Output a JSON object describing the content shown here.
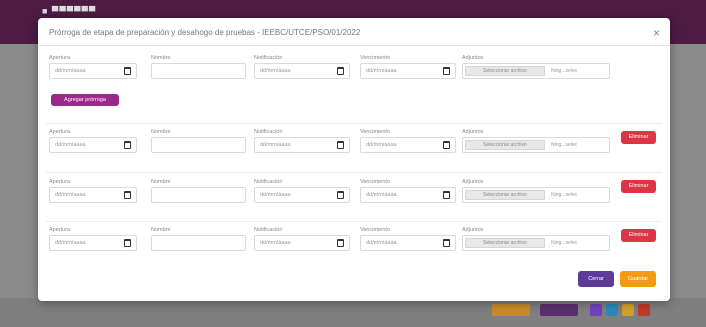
{
  "background": {
    "brand": "■ ▀▀▀▀▀▀"
  },
  "modal": {
    "title": "Prórroga de etapa de preparación y desahogo de pruebas - IEEBC/UTCE/PSO/01/2022"
  },
  "fields": {
    "apertura": "Apertura",
    "nombre": "Nombre",
    "notificacion": "Notificación",
    "vencimiento": "Vencimiento",
    "adjuntos": "Adjuntos"
  },
  "placeholders": {
    "date": "dd/mm/aaaa",
    "file_button": "Seleccionar archivo",
    "file_none": "Ning...selec"
  },
  "buttons": {
    "add_row": "Agregar prórroga",
    "remove": "Eliminar",
    "close": "Cerrar",
    "save": "Guardar"
  },
  "colors": {
    "header": "#4d1a43",
    "purple": "#9a2a8a",
    "red": "#dc3545",
    "orange": "#f39c12",
    "violet": "#5b3a9a"
  }
}
